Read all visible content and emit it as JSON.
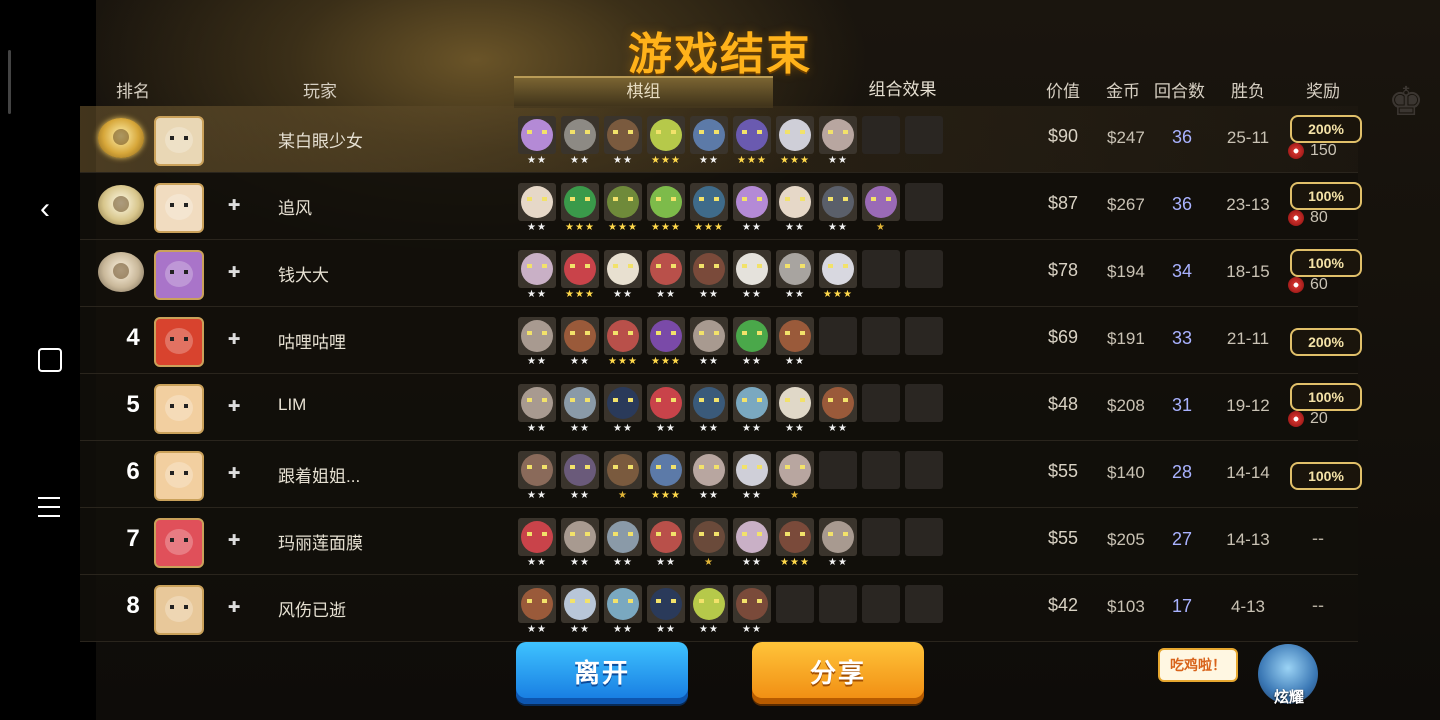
{
  "title": "游戏结束",
  "headers": {
    "rank": "排名",
    "player": "玩家",
    "value": "价值",
    "gold": "金币",
    "rounds": "回合数",
    "win_loss": "胜负",
    "reward": "奖励"
  },
  "tabs": [
    {
      "label": "棋组",
      "active": true
    },
    {
      "label": "组合效果",
      "active": false
    }
  ],
  "rows": [
    {
      "rank": "1",
      "medal": "gold",
      "name": "某白眼少女",
      "value": "$90",
      "gold": "$247",
      "rounds": "36",
      "wl": "25-11",
      "reward_pct": "200%",
      "reward_amount": "150",
      "avatar_color": "#e9d7b5",
      "pieces": [
        {
          "c": "#b48ad6",
          "s": 2
        },
        {
          "c": "#8d8a84",
          "s": 2
        },
        {
          "c": "#7a5a3e",
          "s": 2
        },
        {
          "c": "#b6c94a",
          "s": 3
        },
        {
          "c": "#5c7aa8",
          "s": 2
        },
        {
          "c": "#6a5ab0",
          "s": 3
        },
        {
          "c": "#cfcfd8",
          "s": 3
        },
        {
          "c": "#b8a6a0",
          "s": 2
        }
      ]
    },
    {
      "rank": "2",
      "medal": "silver",
      "name": "追风",
      "value": "$87",
      "gold": "$267",
      "rounds": "36",
      "wl": "23-13",
      "reward_pct": "100%",
      "reward_amount": "80",
      "avatar_color": "#f1dcc0",
      "pieces": [
        {
          "c": "#e6d8c8",
          "s": 2
        },
        {
          "c": "#3a9a4a",
          "s": 3
        },
        {
          "c": "#6f8a3a",
          "s": 3
        },
        {
          "c": "#7dbb4a",
          "s": 3
        },
        {
          "c": "#3f6b8a",
          "s": 3
        },
        {
          "c": "#b48ad6",
          "s": 2
        },
        {
          "c": "#e6d8c8",
          "s": 2
        },
        {
          "c": "#5a5f6a",
          "s": 2
        },
        {
          "c": "#9a6ab6",
          "s": 1
        }
      ]
    },
    {
      "rank": "3",
      "medal": "bronze",
      "name": "钱大大",
      "value": "$78",
      "gold": "$194",
      "rounds": "34",
      "wl": "18-15",
      "reward_pct": "100%",
      "reward_amount": "60",
      "avatar_color": "#a974c9",
      "pieces": [
        {
          "c": "#c9b0c6",
          "s": 2
        },
        {
          "c": "#c9434a",
          "s": 3
        },
        {
          "c": "#e8e0d0",
          "s": 2
        },
        {
          "c": "#b9504a",
          "s": 2
        },
        {
          "c": "#7a4a3a",
          "s": 2
        },
        {
          "c": "#e5e2dc",
          "s": 2
        },
        {
          "c": "#a8a4a0",
          "s": 2
        },
        {
          "c": "#d8d8e0",
          "s": 3
        }
      ]
    },
    {
      "rank": "4",
      "medal": "",
      "name": "咕哩咕哩",
      "value": "$69",
      "gold": "$191",
      "rounds": "33",
      "wl": "21-11",
      "reward_pct": "200%",
      "reward_amount": "",
      "avatar_color": "#d8432e",
      "pieces": [
        {
          "c": "#a89a90",
          "s": 2
        },
        {
          "c": "#9a5a3a",
          "s": 2
        },
        {
          "c": "#b9504a",
          "s": 3
        },
        {
          "c": "#7a4aa8",
          "s": 3
        },
        {
          "c": "#a89a90",
          "s": 2
        },
        {
          "c": "#4aa84a",
          "s": 2
        },
        {
          "c": "#9a5a3a",
          "s": 2
        }
      ]
    },
    {
      "rank": "5",
      "medal": "",
      "name": "LIM",
      "value": "$48",
      "gold": "$208",
      "rounds": "31",
      "wl": "19-12",
      "reward_pct": "100%",
      "reward_amount": "20",
      "avatar_color": "#f2cfa0",
      "pieces": [
        {
          "c": "#a89a90",
          "s": 2
        },
        {
          "c": "#8a9aa8",
          "s": 2
        },
        {
          "c": "#2a3a5a",
          "s": 2
        },
        {
          "c": "#c9434a",
          "s": 2
        },
        {
          "c": "#3a5a7a",
          "s": 2
        },
        {
          "c": "#7aa8c0",
          "s": 2
        },
        {
          "c": "#e0d8c8",
          "s": 2
        },
        {
          "c": "#9a5a3a",
          "s": 2
        }
      ]
    },
    {
      "rank": "6",
      "medal": "",
      "name": "跟着姐姐...",
      "value": "$55",
      "gold": "$140",
      "rounds": "28",
      "wl": "14-14",
      "reward_pct": "100%",
      "reward_amount": "",
      "avatar_color": "#f2cfa0",
      "pieces": [
        {
          "c": "#8a6a5a",
          "s": 2
        },
        {
          "c": "#6a5a7a",
          "s": 2
        },
        {
          "c": "#7a5a3e",
          "s": 1
        },
        {
          "c": "#5c7aa8",
          "s": 3
        },
        {
          "c": "#b8a6a0",
          "s": 2
        },
        {
          "c": "#cfcfd8",
          "s": 2
        },
        {
          "c": "#b8a6a0",
          "s": 1
        }
      ]
    },
    {
      "rank": "7",
      "medal": "",
      "name": "玛丽莲面膜",
      "value": "$55",
      "gold": "$205",
      "rounds": "27",
      "wl": "14-13",
      "reward_pct": "",
      "reward_amount": "",
      "avatar_color": "#e0505a",
      "pieces": [
        {
          "c": "#c9434a",
          "s": 2
        },
        {
          "c": "#a89a90",
          "s": 2
        },
        {
          "c": "#8a9aa8",
          "s": 2
        },
        {
          "c": "#b9504a",
          "s": 2
        },
        {
          "c": "#6a4a3a",
          "s": 1
        },
        {
          "c": "#c9b0c6",
          "s": 2
        },
        {
          "c": "#7a4a3a",
          "s": 3
        },
        {
          "c": "#a89a90",
          "s": 2
        }
      ]
    },
    {
      "rank": "8",
      "medal": "",
      "name": "风伤已逝",
      "value": "$42",
      "gold": "$103",
      "rounds": "17",
      "wl": "4-13",
      "reward_pct": "",
      "reward_amount": "",
      "avatar_color": "#e8c89a",
      "pieces": [
        {
          "c": "#9a5a3a",
          "s": 2
        },
        {
          "c": "#b8c6d8",
          "s": 2
        },
        {
          "c": "#7aa8c0",
          "s": 2
        },
        {
          "c": "#2a3a5a",
          "s": 2
        },
        {
          "c": "#b6c94a",
          "s": 2
        },
        {
          "c": "#7a4a3a",
          "s": 2
        }
      ]
    }
  ],
  "buttons": {
    "leave": "离开",
    "share": "分享"
  },
  "show_off": {
    "bubble": "吃鸡啦！",
    "label": "炫耀"
  },
  "empty_reward": "--",
  "colors": {
    "title": "#ffb21a",
    "rounds": "#a9b2ff",
    "badge_border": "#e1c06a"
  }
}
